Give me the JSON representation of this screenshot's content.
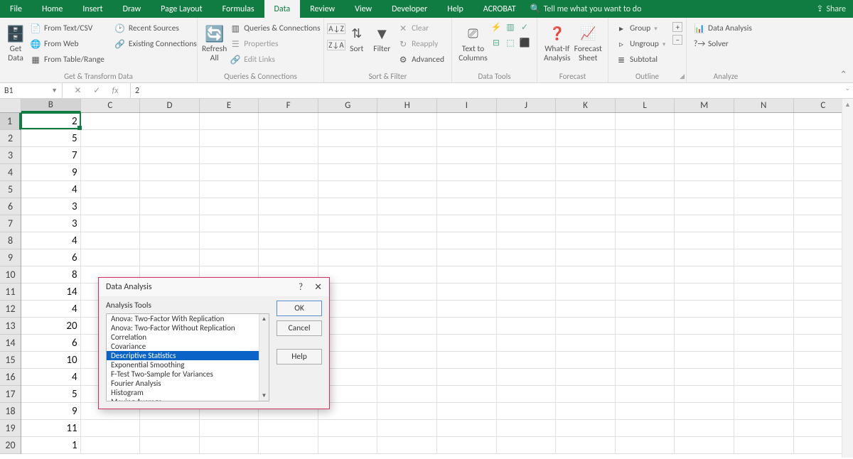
{
  "menubar": {
    "tabs": [
      "File",
      "Home",
      "Insert",
      "Draw",
      "Page Layout",
      "Formulas",
      "Data",
      "Review",
      "View",
      "Developer",
      "Help",
      "ACROBAT"
    ],
    "active_index": 6,
    "tellme_placeholder": "Tell me what you want to do",
    "share_label": "Share"
  },
  "ribbon": {
    "groups": [
      {
        "title": "Get & Transform Data",
        "big": {
          "label": "Get\nData",
          "dropdown": true
        },
        "items": [
          {
            "icon": "📄",
            "label": "From Text/CSV"
          },
          {
            "icon": "🌐",
            "label": "From Web"
          },
          {
            "icon": "▦",
            "label": "From Table/Range"
          },
          {
            "icon": "🕑",
            "label": "Recent Sources"
          },
          {
            "icon": "🔗",
            "label": "Existing Connections"
          }
        ]
      },
      {
        "title": "Queries & Connections",
        "big": {
          "label": "Refresh\nAll",
          "dropdown": true
        },
        "items": [
          {
            "icon": "▥",
            "label": "Queries & Connections"
          },
          {
            "icon": "☰",
            "label": "Properties",
            "dim": true
          },
          {
            "icon": "🔗",
            "label": "Edit Links",
            "dim": true
          }
        ]
      },
      {
        "title": "Sort & Filter",
        "sort_az": "A→Z",
        "sort_za": "Z→A",
        "sort_big": "Sort",
        "filter_big": "Filter",
        "items": [
          {
            "icon": "✕",
            "label": "Clear",
            "dim": true
          },
          {
            "icon": "↻",
            "label": "Reapply",
            "dim": true
          },
          {
            "icon": "⚙",
            "label": "Advanced"
          }
        ]
      },
      {
        "title": "Data Tools",
        "big": {
          "label": "Text to\nColumns"
        },
        "small_icons": [
          "⚡",
          "▥",
          "✓",
          "⊟",
          "⬚",
          "⬛"
        ]
      },
      {
        "title": "Forecast",
        "items": [
          {
            "label": "What-If\nAnalysis",
            "dropdown": true
          },
          {
            "label": "Forecast\nSheet"
          }
        ]
      },
      {
        "title": "Outline",
        "items": [
          {
            "icon": "▸",
            "label": "Group",
            "dropdown": true
          },
          {
            "icon": "▹",
            "label": "Ungroup",
            "dropdown": true
          },
          {
            "icon": "≣",
            "label": "Subtotal"
          }
        ],
        "side_icons": [
          "+",
          "−"
        ]
      },
      {
        "title": "Analyze",
        "items": [
          {
            "icon": "📊",
            "label": "Data Analysis"
          },
          {
            "icon": "?→",
            "label": "Solver"
          }
        ]
      }
    ]
  },
  "formula_bar": {
    "namebox": "B1",
    "value": "2"
  },
  "grid": {
    "columns": [
      "B",
      "C",
      "D",
      "E",
      "F",
      "G",
      "H",
      "I",
      "J",
      "K",
      "L",
      "M",
      "N",
      "C"
    ],
    "row_count": 20,
    "active": {
      "col_index": 0,
      "row_index": 0
    },
    "col_B_data": [
      2,
      5,
      7,
      9,
      4,
      3,
      3,
      4,
      6,
      8,
      14,
      4,
      20,
      6,
      10,
      4,
      5,
      9,
      11,
      1
    ]
  },
  "dialog": {
    "title": "Data Analysis",
    "group_label": "Analysis Tools",
    "items": [
      "Anova: Two-Factor With Replication",
      "Anova: Two-Factor Without Replication",
      "Correlation",
      "Covariance",
      "Descriptive Statistics",
      "Exponential Smoothing",
      "F-Test Two-Sample for Variances",
      "Fourier Analysis",
      "Histogram",
      "Moving Average"
    ],
    "selected_index": 4,
    "buttons": {
      "ok": "OK",
      "cancel": "Cancel",
      "help": "Help"
    },
    "help_icon": "?",
    "close_icon": "✕"
  }
}
